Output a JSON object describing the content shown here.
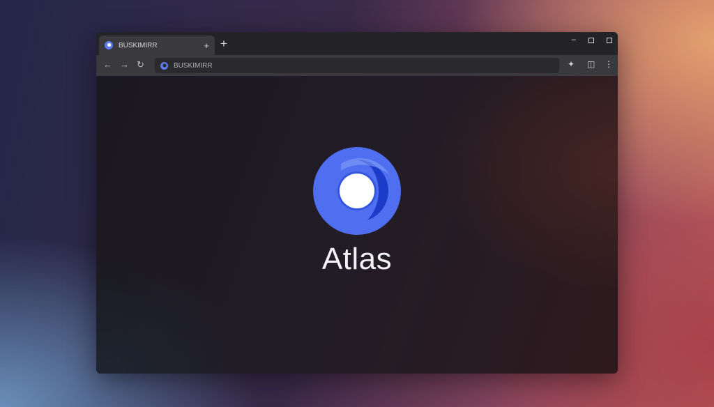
{
  "tab": {
    "title": "BUSKIMIRR",
    "close_icon": "plus-icon"
  },
  "new_tab_label": "+",
  "window_controls": {
    "minimize": "–",
    "close": "▪"
  },
  "nav": {
    "back": "←",
    "forward": "→",
    "reload": "↻"
  },
  "address_bar": {
    "text": "BUSKIMIRR"
  },
  "toolbar_icons": {
    "extensions": "✦",
    "sidebar": "◫",
    "menu": "⋮"
  },
  "page": {
    "brand_name": "Atlas"
  },
  "colors": {
    "logo_blue": "#4f6ff0",
    "logo_dark_blue": "#1a3cc8"
  }
}
